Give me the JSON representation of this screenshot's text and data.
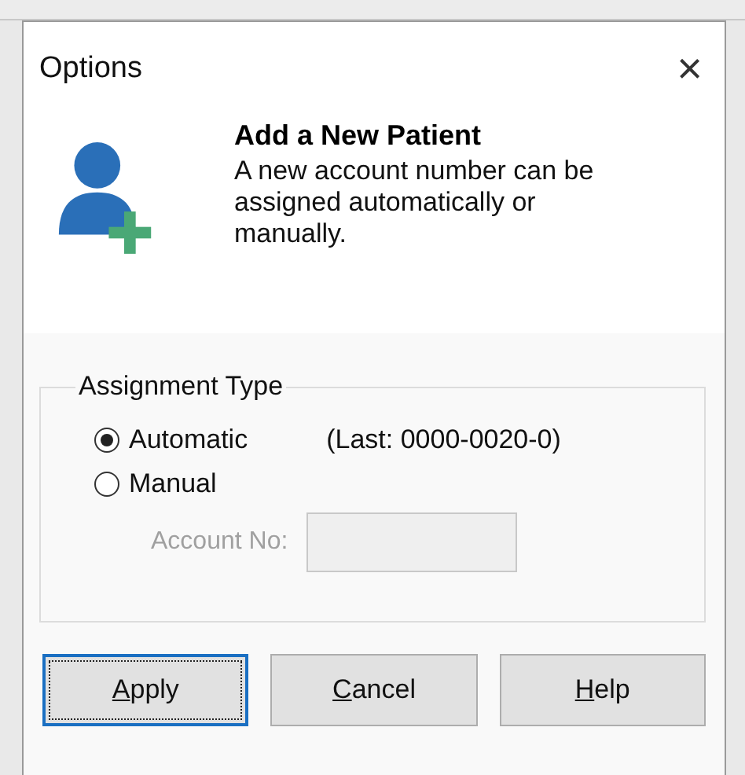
{
  "window": {
    "title": "Options",
    "close": "×"
  },
  "header": {
    "title": "Add a New Patient",
    "description": "A new account number can be assigned automatically or manually."
  },
  "assignment_type": {
    "legend": "Assignment Type",
    "options": [
      {
        "label": "Automatic",
        "selected": true,
        "note": "(Last:  0000-0020-0)"
      },
      {
        "label": "Manual",
        "selected": false
      }
    ],
    "account_no": {
      "label": "Account No:",
      "disabled": true
    }
  },
  "buttons": [
    {
      "label": "Apply",
      "first_letter_underlined": true,
      "focused": true
    },
    {
      "label": "Cancel",
      "first_letter_underlined": true,
      "focused": false
    },
    {
      "label": "Help",
      "first_letter_underlined": true,
      "focused": false
    }
  ]
}
